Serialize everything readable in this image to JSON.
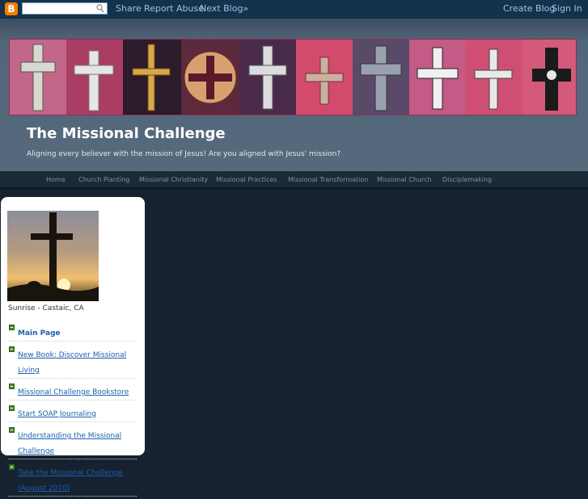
{
  "navbar": {
    "logo_letter": "B",
    "search_placeholder": "",
    "share": "Share",
    "report_abuse": "Report Abuse",
    "next_blog": "Next Blog»",
    "create_blog": "Create Blog",
    "sign_in": "Sign In"
  },
  "header": {
    "title": "The Missional Challenge",
    "description": "Aligning every believer with the mission of Jesus! Are you aligned with Jesus' mission?"
  },
  "tabs": [
    {
      "label": "Home"
    },
    {
      "label": "Church Planting"
    },
    {
      "label": "Missional Christianity"
    },
    {
      "label": "Missional Practices"
    },
    {
      "label": "Missional Transformation"
    },
    {
      "label": "Missional Church"
    },
    {
      "label": "Disciplemaking"
    }
  ],
  "sidebar": {
    "photo_caption": "Sunrise - Castaic, CA",
    "links": [
      {
        "label": "Main Page"
      },
      {
        "label": "New Book: Discover Missional Living"
      },
      {
        "label": "Missional Challenge Bookstore"
      },
      {
        "label": "Start SOAP Journaling"
      },
      {
        "label": "Understanding the Missional Challenge"
      },
      {
        "label": "Take the Missional Challenge (August 2010)"
      }
    ]
  },
  "colors": {
    "navbar_bg": "#13334d",
    "link_color": "#9bc2e6",
    "page_bg": "#16222f",
    "banner_accent": "#c24a70",
    "sidebar_link": "#1c5fad"
  }
}
